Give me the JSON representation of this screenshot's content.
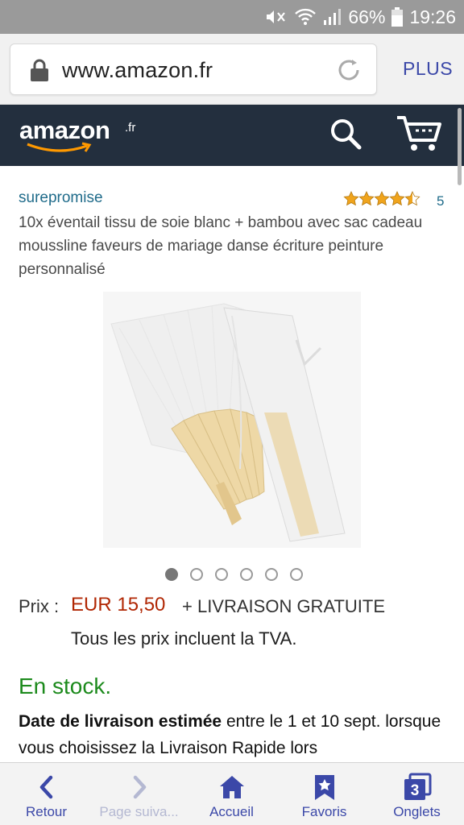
{
  "status_bar": {
    "battery": "66%",
    "time": "19:26"
  },
  "browser": {
    "url": "www.amazon.fr",
    "plus_label": "PLUS"
  },
  "amazon_header": {
    "logo_text": "amazon",
    "logo_suffix": ".fr"
  },
  "product": {
    "seller": "surepromise",
    "rating_stars": 4.5,
    "review_count": "5",
    "title": "10x éventail tissu de soie blanc + bambou avec sac cadeau moussline faveurs de mariage danse écriture peinture personnalisé",
    "image_dots": 6,
    "active_dot": 0,
    "price_label": "Prix :",
    "price": "EUR 15,50",
    "shipping": "+ LIVRAISON GRATUITE",
    "vat_note": "Tous les prix incluent la TVA.",
    "stock": "En stock.",
    "delivery_bold": "Date de livraison estimée",
    "delivery_text": " entre le 1 et 10 sept. lorsque vous choisissez la Livraison Rapide lors"
  },
  "bottom_nav": {
    "back": "Retour",
    "forward": "Page suiva...",
    "home": "Accueil",
    "bookmarks": "Favoris",
    "tabs": "Onglets",
    "tab_count": "3"
  },
  "colors": {
    "status_bar": "#9a9a9a",
    "amazon_header": "#232f3e",
    "price": "#b12704",
    "stock": "#1c8a1c",
    "link": "#1f6b8a",
    "nav_accent": "#3b48a8"
  }
}
